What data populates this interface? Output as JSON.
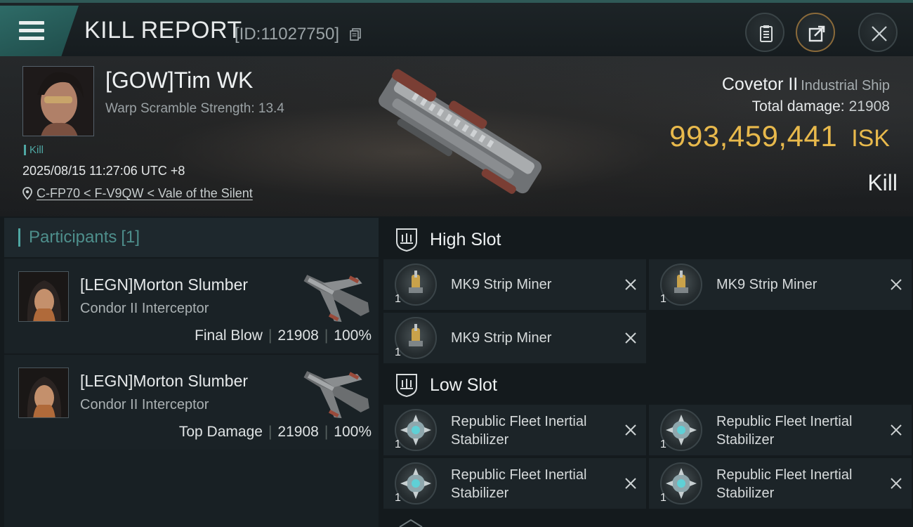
{
  "header": {
    "title": "KILL REPORT",
    "report_id": "[ID:11027750]"
  },
  "victim": {
    "name": "[GOW]Tim WK",
    "warp_scramble": "Warp Scramble Strength: 13.4",
    "tag": "Kill",
    "datetime": "2025/08/15 11:27:06 UTC +8",
    "location": "C-FP70 < F-V9QW < Vale of the Silent",
    "ship_name": "Covetor II",
    "ship_class": "Industrial Ship",
    "total_damage_label": "Total damage:",
    "total_damage": "21908",
    "isk_value": "993,459,441",
    "isk_unit": "ISK",
    "result": "Kill"
  },
  "participants": {
    "label": "Participants",
    "count": "[1]",
    "rows": [
      {
        "name": "[LEGN]Morton Slumber",
        "ship": "Condor II Interceptor",
        "role": "Final Blow",
        "damage": "21908",
        "percent": "100%"
      },
      {
        "name": "[LEGN]Morton Slumber",
        "ship": "Condor II Interceptor",
        "role": "Top Damage",
        "damage": "21908",
        "percent": "100%"
      }
    ]
  },
  "fitting": {
    "high_slot": {
      "title": "High Slot",
      "modules": [
        {
          "name": "MK9 Strip Miner",
          "qty": "1"
        },
        {
          "name": "MK9 Strip Miner",
          "qty": "1"
        },
        {
          "name": "MK9 Strip Miner",
          "qty": "1"
        }
      ]
    },
    "low_slot": {
      "title": "Low Slot",
      "modules": [
        {
          "name": "Republic Fleet Inertial Stabilizer",
          "qty": "1"
        },
        {
          "name": "Republic Fleet Inertial Stabilizer",
          "qty": "1"
        },
        {
          "name": "Republic Fleet Inertial Stabilizer",
          "qty": "1"
        },
        {
          "name": "Republic Fleet Inertial Stabilizer",
          "qty": "1"
        }
      ]
    }
  },
  "colors": {
    "accent": "#4fa7a3",
    "isk": "#e8b94c",
    "background": "#141a1d"
  }
}
